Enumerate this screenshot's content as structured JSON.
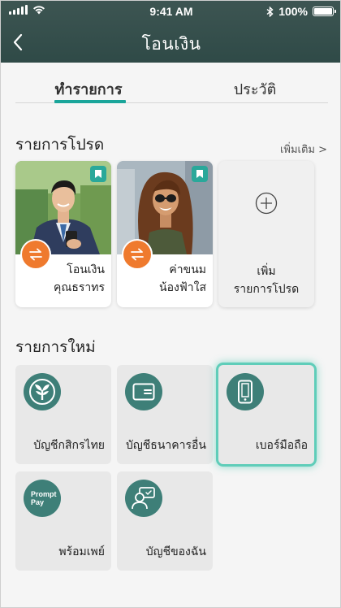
{
  "status_bar": {
    "time": "9:41 AM",
    "battery": "100%",
    "battery_level": 1.0
  },
  "nav": {
    "title": "โอนเงิน"
  },
  "tabs": [
    {
      "label": "ทำรายการ",
      "active": true
    },
    {
      "label": "ประวัติ",
      "active": false
    }
  ],
  "favorites": {
    "section_title": "รายการโปรด",
    "see_more": "เพิ่มเติม >",
    "items": [
      {
        "line1": "โอนเงิน",
        "line2": "คุณธราทร"
      },
      {
        "line1": "ค่าขนม",
        "line2": "น้องฟ้าใส"
      }
    ],
    "add": {
      "line1": "เพิ่ม",
      "line2": "รายการโปรด"
    }
  },
  "new_items": {
    "section_title": "รายการใหม่",
    "tiles": [
      {
        "label": "บัญชีกสิกรไทย",
        "icon": "kbank-logo-icon"
      },
      {
        "label": "บัญชีธนาคารอื่น",
        "icon": "card-icon"
      },
      {
        "label": "เบอร์มือถือ",
        "icon": "mobile-phone-icon",
        "selected": true
      },
      {
        "label": "พร้อมเพย์",
        "icon": "promptpay-icon",
        "icon_text": "Prompt Pay"
      },
      {
        "label": "บัญชีของฉัน",
        "icon": "my-account-icon"
      }
    ]
  },
  "colors": {
    "header": "#2f4a47",
    "accent": "#1aa59a",
    "swap_badge": "#ef7a2e",
    "tile_icon": "#3e7f78",
    "highlight": "#5fcdb9"
  }
}
